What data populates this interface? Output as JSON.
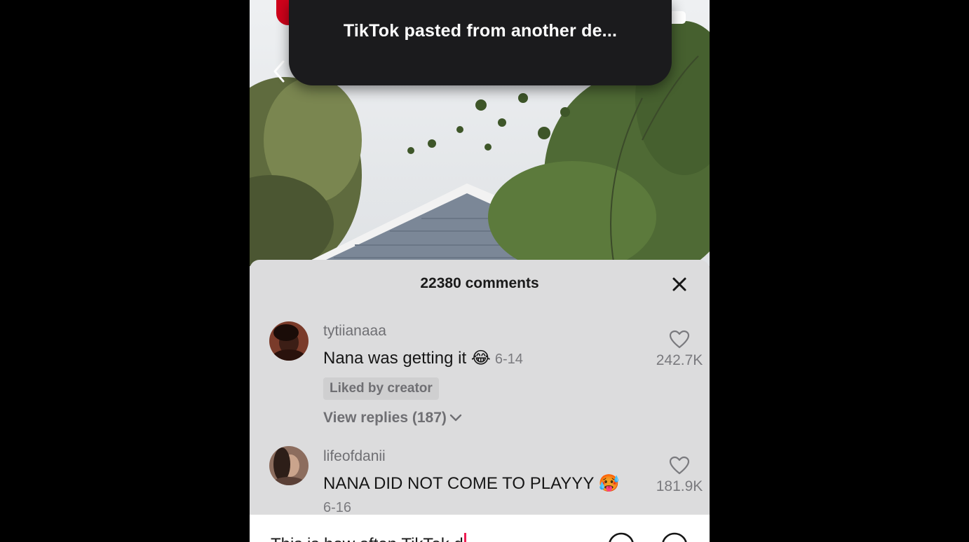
{
  "toast": {
    "message": "TikTok pasted from another de..."
  },
  "comments_sheet": {
    "title": "22380 comments",
    "comments": [
      {
        "username": "tytiianaaa",
        "text": "Nana was getting it 😂",
        "date": "6-14",
        "badge": "Liked by creator",
        "view_replies": "View replies (187)",
        "likes": "242.7K"
      },
      {
        "username": "lifeofdanii",
        "text": "NANA DID NOT COME TO PLAYYY 🥵",
        "date": "6-16",
        "likes": "181.9K"
      }
    ]
  },
  "input_bar": {
    "value": "This is how often TikTok d"
  },
  "colors": {
    "accent": "#ee1d52",
    "sheet_bg": "#dcdcdd",
    "toast_bg": "#1b1b1d"
  },
  "icons": [
    "chevron-left-icon",
    "close-icon",
    "heart-icon",
    "chevron-down-icon",
    "at-icon",
    "emoji-icon",
    "battery-icon"
  ]
}
